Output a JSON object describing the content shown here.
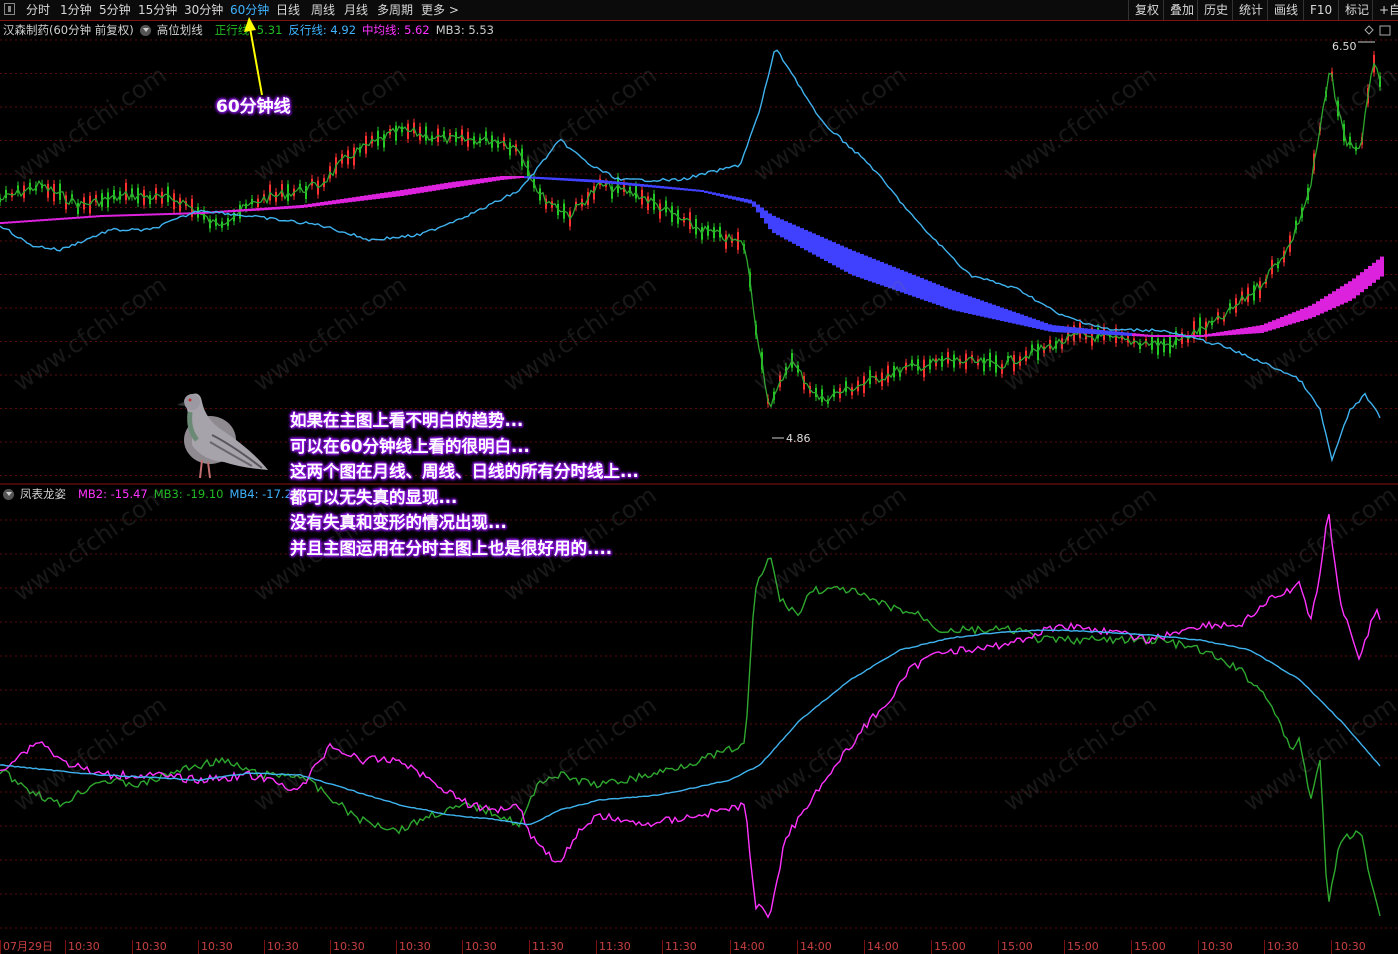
{
  "toolbar": {
    "periods": [
      "分时",
      "1分钟",
      "5分钟",
      "15分钟",
      "30分钟",
      "60分钟",
      "日线",
      "周线",
      "月线",
      "多周期",
      "更多 >"
    ],
    "active_period": "60分钟",
    "right_buttons": [
      "复权",
      "叠加",
      "历史",
      "统计",
      "画线",
      "F10",
      "标记",
      "+自"
    ]
  },
  "main_chart": {
    "title": "汉森制药(60分钟 前复权)",
    "indicator": "高位划线",
    "values": [
      {
        "label": "正行线:",
        "value": "5.31",
        "color": "#22bb22"
      },
      {
        "label": "反行线:",
        "value": "4.92",
        "color": "#3fb3ff"
      },
      {
        "label": "中均线:",
        "value": "5.62",
        "color": "#ff33ff"
      },
      {
        "label": "MB3:",
        "value": "5.53",
        "color": "#cccccc"
      }
    ],
    "high_label": "6.50",
    "low_label": "4.86"
  },
  "sub_chart": {
    "indicator": "凤表龙姿",
    "values": [
      {
        "label": "MB2:",
        "value": "-15.47",
        "color": "#ff33ff"
      },
      {
        "label": "MB3:",
        "value": "-19.10",
        "color": "#22bb22"
      },
      {
        "label": "MB4:",
        "value": "-17.29",
        "color": "#3fb3ff"
      }
    ]
  },
  "annotation_arrow_label": "60分钟线",
  "annotation_lines": [
    "如果在主图上看不明白的趋势...",
    "可以在60分钟线上看的很明白...",
    "这两个图在月线、周线、日线的所有分时线上...",
    "都可以无失真的显现...",
    "没有失真和变形的情况出现...",
    "并且主图运用在分时主图上也是很好用的...."
  ],
  "time_axis": [
    "07月29日",
    "10:30",
    "10:30",
    "10:30",
    "10:30",
    "10:30",
    "10:30",
    "10:30",
    "11:30",
    "11:30",
    "11:30",
    "14:00",
    "14:00",
    "14:00",
    "15:00",
    "15:00",
    "15:00",
    "15:00",
    "10:30",
    "10:30",
    "10:30"
  ],
  "watermark": "www.cfchi.com",
  "colors": {
    "up_candle": "#ff3030",
    "down_candle": "#22cc22",
    "grid": "#5a0c0c",
    "ribbon_down": "#4040ff",
    "ribbon_up": "#dd22dd"
  }
}
